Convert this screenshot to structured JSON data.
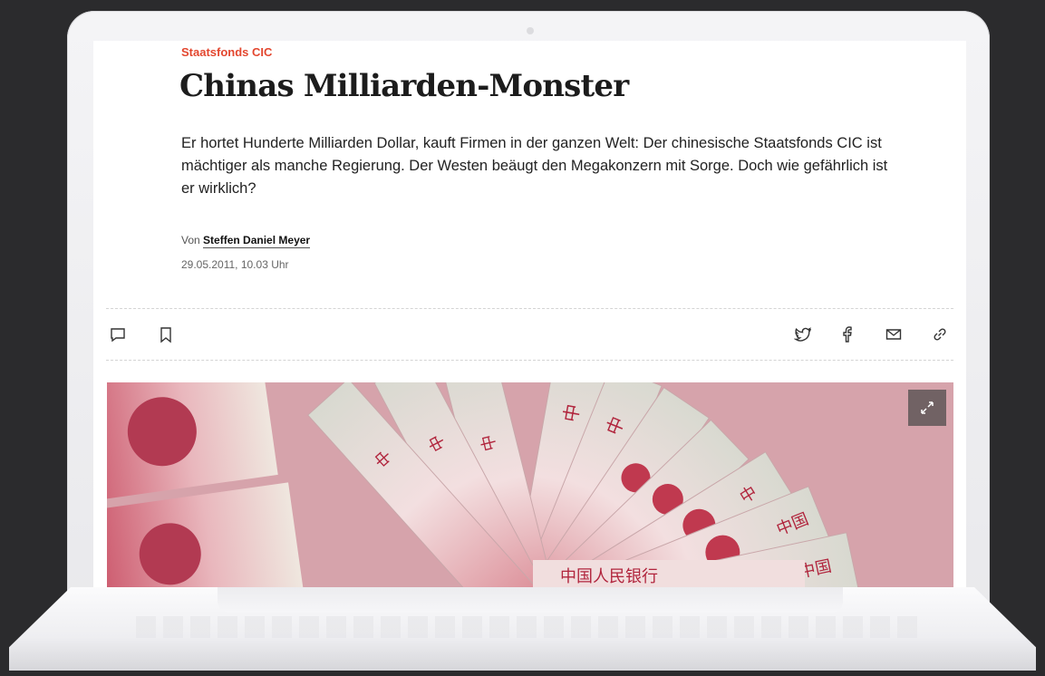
{
  "article": {
    "kicker": "Staatsfonds CIC",
    "headline": "Chinas Milliarden-Monster",
    "lead": "Er hortet Hunderte Milliarden Dollar, kauft Firmen in der ganzen Welt: Der chinesische Staatsfonds CIC ist mächtiger als manche Regierung. Der Westen beäugt den Megakonzern mit Sorge. Doch wie gefährlich ist er wirklich?",
    "byline_prefix": "Von",
    "author": "Steffen Daniel Meyer",
    "date": "29.05.2011, 10.03 Uhr"
  },
  "toolbar": {
    "left_icons": [
      "comment-icon",
      "bookmark-icon"
    ],
    "right_icons": [
      "twitter-icon",
      "facebook-icon",
      "mail-icon",
      "link-icon"
    ]
  },
  "hero_image": {
    "subject": "fanned-out yuan banknotes",
    "expand_icon": "expand-icon"
  },
  "colors": {
    "kicker": "#e3472f",
    "headline": "#1c1c1c",
    "background": "#2b2b2d",
    "laptop": "#f2f2f4"
  }
}
